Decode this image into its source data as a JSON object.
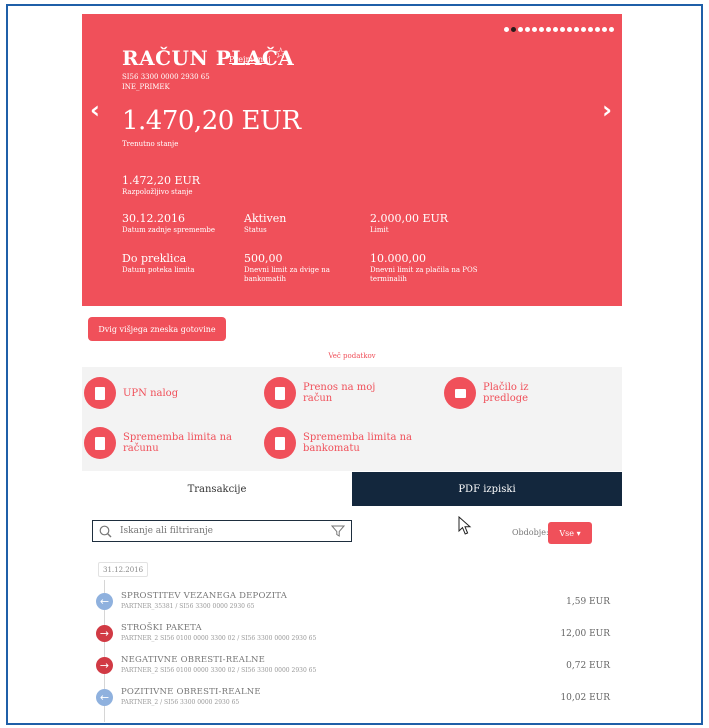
{
  "account": {
    "name": "RAČUN PLAČA",
    "rename_label": "Preimenuj",
    "favorite_icon": "star-outline-icon",
    "iban": "SI56 3300 0000 2930 65",
    "code": "INE_PRIMEK",
    "balance": "1.470,20 EUR",
    "balance_label": "Trenutno stanje",
    "available": "1.472,20 EUR",
    "available_label": "Razpoložljivo stanje",
    "stats": [
      {
        "value": "30.12.2016",
        "label": "Datum zadnje spremembe"
      },
      {
        "value": "Aktiven",
        "label": "Status"
      },
      {
        "value": "2.000,00 EUR",
        "label": "Limit"
      },
      {
        "value": "Do preklica",
        "label": "Datum poteka limita"
      },
      {
        "value": "500,00",
        "label": "Dnevni limit za dvige na bankomatih"
      },
      {
        "value": "10.000,00",
        "label": "Dnevni limit za plačila na POS terminalih"
      }
    ],
    "carousel": {
      "total": 16,
      "active": 2
    },
    "colors": {
      "accent": "#f0505a",
      "dark": "#13273d"
    }
  },
  "buttons": {
    "withdraw": "Dvig višjega zneska gotovine",
    "more_data": "Več podatkov"
  },
  "actions": [
    {
      "label": "UPN nalog"
    },
    {
      "label": "Prenos na moj račun"
    },
    {
      "label": "Plačilo iz predloge"
    },
    {
      "label": "Sprememba limita na računu"
    },
    {
      "label": "Sprememba limita na bankomatu"
    }
  ],
  "tabs": {
    "transactions": "Transakcije",
    "pdf": "PDF izpiski"
  },
  "search": {
    "placeholder": "Iskanje ali filtriranje"
  },
  "period": {
    "label": "Obdobje:",
    "value": "Vse ▾"
  },
  "transactions": {
    "date": "31.12.2016",
    "items": [
      {
        "title": "SPROSTITEV VEZANEGA DEPOZITA",
        "sub": "PARTNER_35381 / SI56 3300 0000 2930 65",
        "amount": "1,59 EUR",
        "direction": "in"
      },
      {
        "title": "STROŠKI PAKETA",
        "sub": "PARTNER_2  SI56 0100 0000 3300 02  / SI56 3300 0000 2930 65",
        "amount": "12,00 EUR",
        "direction": "out"
      },
      {
        "title": "NEGATIVNE OBRESTI-REALNE",
        "sub": "PARTNER_2  SI56 0100 0000 3300 02  / SI56 3300 0000 2930 65",
        "amount": "0,72 EUR",
        "direction": "out"
      },
      {
        "title": "POZITIVNE OBRESTI-REALNE",
        "sub": "PARTNER_2 / SI56 3300 0000 2930 65",
        "amount": "10,02 EUR",
        "direction": "in"
      }
    ]
  }
}
